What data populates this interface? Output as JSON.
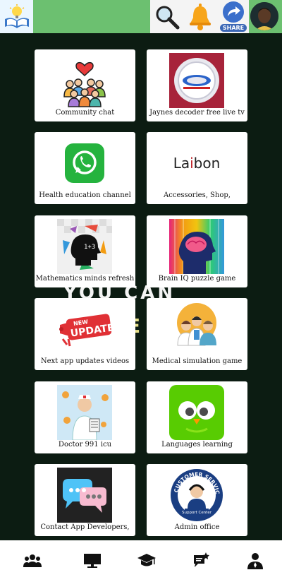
{
  "header": {
    "logo": "open-book-lightbulb-logo",
    "share_label": "SHARE"
  },
  "background": {
    "slogan_text": "YOU CAN"
  },
  "cards": [
    {
      "label": "Community chat",
      "icon": "community-group-icon"
    },
    {
      "label": "Jaynes decoder free live tv",
      "icon": "decoder-logo"
    },
    {
      "label": "Health education channel",
      "icon": "whatsapp-icon"
    },
    {
      "label": "Accessories, Shop,",
      "icon": "labon-logo",
      "logo_text": "Labon"
    },
    {
      "label": "Mathematics minds refresh",
      "icon": "math-mind-icon"
    },
    {
      "label": "Brain IQ puzzle game",
      "icon": "brain-icon"
    },
    {
      "label": "Next app updates videos",
      "icon": "update-megaphone-icon",
      "badge_new": "NEW",
      "badge_text": "UPDATE"
    },
    {
      "label": "Medical simulation game",
      "icon": "doctors-icon"
    },
    {
      "label": "Doctor 991 icu",
      "icon": "nurse-icon"
    },
    {
      "label": "Languages learning",
      "icon": "owl-icon"
    },
    {
      "label": "Contact App Developers,",
      "icon": "chat-bubbles-icon"
    },
    {
      "label": "Admin office",
      "icon": "customer-service-icon",
      "ring_text": "CUSTOMER SERVICE",
      "sub_text": "Support Center"
    }
  ],
  "bottom_nav": [
    {
      "name": "people-icon"
    },
    {
      "name": "desktop-icon"
    },
    {
      "name": "graduation-cap-icon"
    },
    {
      "name": "chat-star-icon"
    },
    {
      "name": "user-icon"
    }
  ]
}
